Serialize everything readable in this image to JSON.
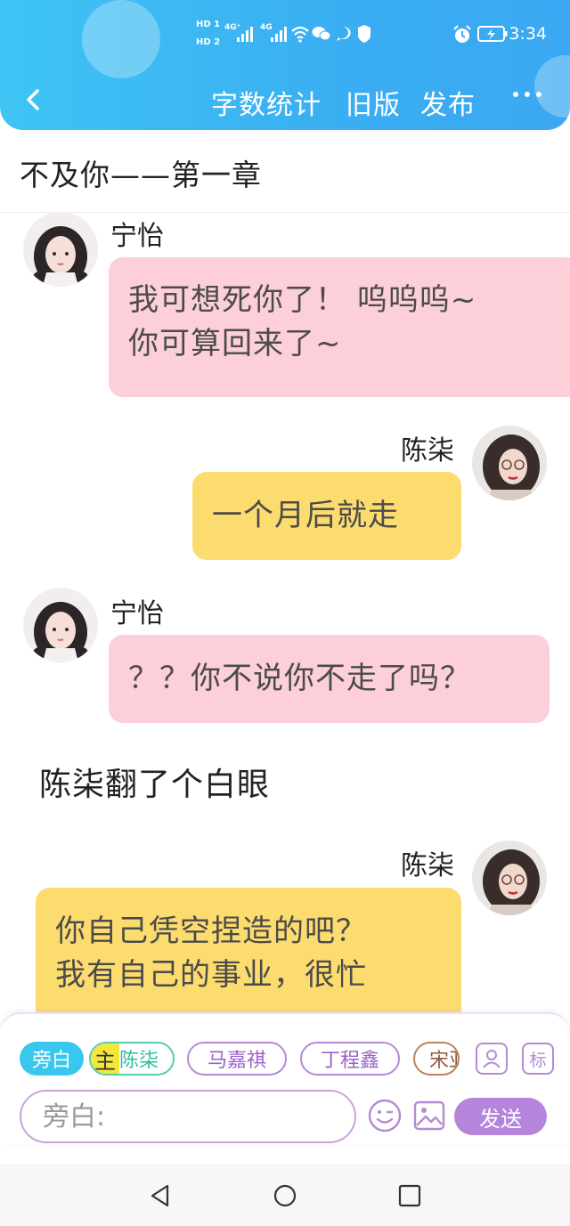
{
  "status_bar": {
    "hd1": "HD 1",
    "hd2": "HD 2",
    "net1": "4G⁺",
    "net2": "4G",
    "time": "3:34"
  },
  "nav": {
    "back_icon": "chevron-left-icon",
    "word_count": "字数统计",
    "old_version": "旧版",
    "publish": "发布",
    "more_icon": "more-horizontal-icon"
  },
  "chapter_title": "不及你——第一章",
  "messages": [
    {
      "speaker": "宁怡",
      "side": "left",
      "color": "#fccfd9",
      "lines": [
        "我可想死你了！ 呜呜呜~",
        "你可算回来了~"
      ]
    },
    {
      "speaker": "陈柒",
      "side": "right",
      "color": "#fcdc6f",
      "lines": [
        "一个月后就走"
      ]
    },
    {
      "speaker": "宁怡",
      "side": "left",
      "color": "#fccfd9",
      "lines": [
        "？？你不说你不走了吗？"
      ]
    },
    {
      "speaker": "陈柒",
      "side": "right",
      "color": "#fcdc6f",
      "lines": [
        "你自己凭空捏造的吧？",
        "我有自己的事业，很忙"
      ]
    }
  ],
  "narration": "陈柒翻了个白眼",
  "toolbar": {
    "chips": {
      "narration": "旁白",
      "main_tag": "主",
      "main_name": "陈柒",
      "c1": "马嘉祺",
      "c2": "丁程鑫",
      "c3": "宋亚轩"
    },
    "add_character_icon": "add-person-icon",
    "tag_label": "标",
    "input_placeholder": "旁白:",
    "emoji_icon": "emoji-wink-icon",
    "image_icon": "image-icon",
    "send": "发送"
  },
  "system_nav": [
    "back-triangle-icon",
    "home-circle-icon",
    "recents-square-icon"
  ],
  "colors": {
    "header": "#3aaef2",
    "pink_bubble": "#fccfd9",
    "yellow_bubble": "#fcdc6f",
    "accent_purple": "#b584db",
    "narration_chip": "#39c7ee"
  }
}
